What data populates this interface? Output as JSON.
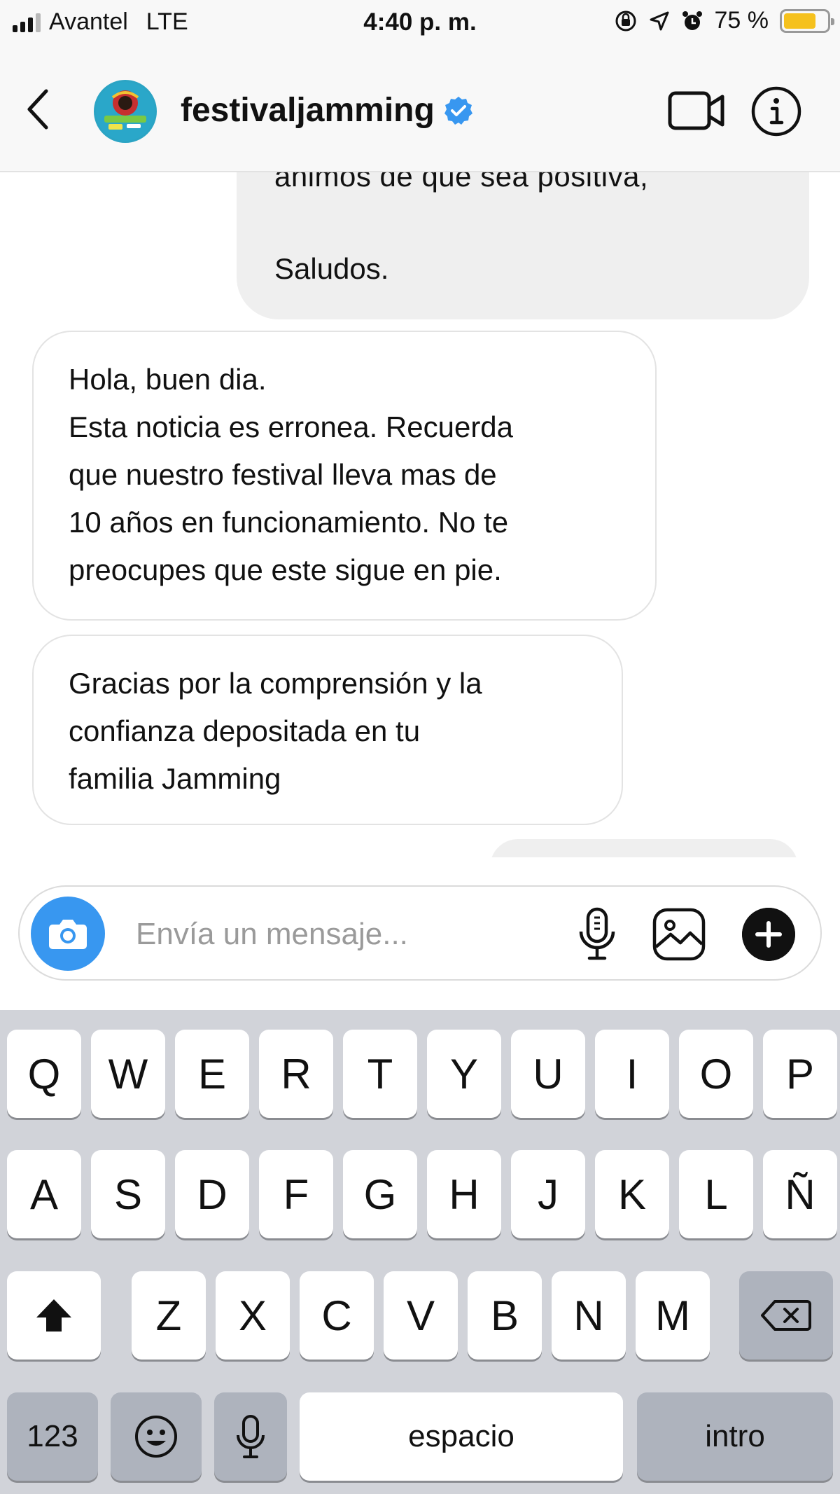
{
  "status_bar": {
    "carrier": "Avantel",
    "network": "LTE",
    "time": "4:40 p. m.",
    "battery": "75 %",
    "battery_level": 0.75,
    "battery_color": "#f5c11d"
  },
  "header": {
    "username": "festivaljamming",
    "verified": true,
    "back_icon": "chevron-left-icon",
    "video_icon": "video-camera-icon",
    "info_icon": "info-icon",
    "accent": "#3897f0"
  },
  "messages": [
    {
      "direction": "outgoing",
      "cut_text": "ánimos de que sea positiva,",
      "text": "Saludos."
    },
    {
      "direction": "incoming",
      "lines": [
        "Hola, buen dia.",
        "Esta noticia es erronea. Recuerda",
        "que nuestro festival lleva mas de",
        "10 años en funcionamiento. No te",
        "preocupes que este sigue en pie."
      ]
    },
    {
      "direction": "incoming",
      "lines": [
        "Gracias por la comprensión y la",
        "confianza depositada en tu",
        "familia Jamming"
      ]
    }
  ],
  "composer": {
    "placeholder": "Envía un mensaje...",
    "value": "",
    "camera_icon": "camera-icon",
    "mic_icon": "microphone-icon",
    "gallery_icon": "image-icon",
    "plus_icon": "plus-circle-icon"
  },
  "keyboard": {
    "row1": [
      "Q",
      "W",
      "E",
      "R",
      "T",
      "Y",
      "U",
      "I",
      "O",
      "P"
    ],
    "row2": [
      "A",
      "S",
      "D",
      "F",
      "G",
      "H",
      "J",
      "K",
      "L",
      "Ñ"
    ],
    "row3": [
      "Z",
      "X",
      "C",
      "V",
      "B",
      "N",
      "M"
    ],
    "numbers_label": "123",
    "space_label": "espacio",
    "return_label": "intro",
    "shift_icon": "shift-arrow-icon",
    "delete_icon": "backspace-icon",
    "emoji_icon": "emoji-icon",
    "dictation_icon": "microphone-icon"
  }
}
